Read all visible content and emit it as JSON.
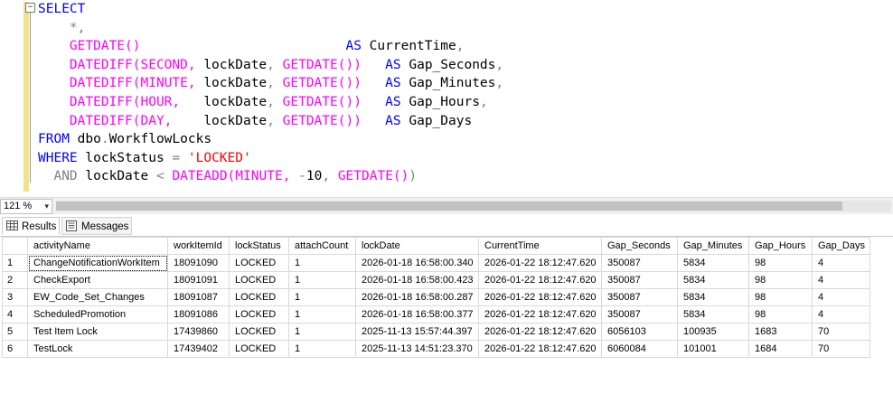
{
  "editor": {
    "lines": [
      [
        {
          "t": "SELECT",
          "c": "kw"
        }
      ],
      [
        {
          "t": "    ",
          "c": "txt"
        },
        {
          "t": "*,",
          "c": "gray"
        }
      ],
      [
        {
          "t": "    ",
          "c": "txt"
        },
        {
          "t": "GETDATE()",
          "c": "fn"
        },
        {
          "t": "                          ",
          "c": "txt"
        },
        {
          "t": "AS",
          "c": "kw"
        },
        {
          "t": " CurrentTime",
          "c": "txt"
        },
        {
          "t": ",",
          "c": "gray"
        }
      ],
      [
        {
          "t": "    ",
          "c": "txt"
        },
        {
          "t": "DATEDIFF(SECOND, ",
          "c": "fn"
        },
        {
          "t": "lockDate",
          "c": "txt"
        },
        {
          "t": ", ",
          "c": "gray"
        },
        {
          "t": "GETDATE())",
          "c": "fn"
        },
        {
          "t": "   ",
          "c": "txt"
        },
        {
          "t": "AS",
          "c": "kw"
        },
        {
          "t": " Gap_Seconds",
          "c": "txt"
        },
        {
          "t": ",",
          "c": "gray"
        }
      ],
      [
        {
          "t": "    ",
          "c": "txt"
        },
        {
          "t": "DATEDIFF(MINUTE, ",
          "c": "fn"
        },
        {
          "t": "lockDate",
          "c": "txt"
        },
        {
          "t": ", ",
          "c": "gray"
        },
        {
          "t": "GETDATE())",
          "c": "fn"
        },
        {
          "t": "   ",
          "c": "txt"
        },
        {
          "t": "AS",
          "c": "kw"
        },
        {
          "t": " Gap_Minutes",
          "c": "txt"
        },
        {
          "t": ",",
          "c": "gray"
        }
      ],
      [
        {
          "t": "    ",
          "c": "txt"
        },
        {
          "t": "DATEDIFF(HOUR,   ",
          "c": "fn"
        },
        {
          "t": "lockDate",
          "c": "txt"
        },
        {
          "t": ", ",
          "c": "gray"
        },
        {
          "t": "GETDATE())",
          "c": "fn"
        },
        {
          "t": "   ",
          "c": "txt"
        },
        {
          "t": "AS",
          "c": "kw"
        },
        {
          "t": " Gap_Hours",
          "c": "txt"
        },
        {
          "t": ",",
          "c": "gray"
        }
      ],
      [
        {
          "t": "    ",
          "c": "txt"
        },
        {
          "t": "DATEDIFF(DAY,    ",
          "c": "fn"
        },
        {
          "t": "lockDate",
          "c": "txt"
        },
        {
          "t": ", ",
          "c": "gray"
        },
        {
          "t": "GETDATE())",
          "c": "fn"
        },
        {
          "t": "   ",
          "c": "txt"
        },
        {
          "t": "AS",
          "c": "kw"
        },
        {
          "t": " Gap_Days",
          "c": "txt"
        }
      ],
      [
        {
          "t": "FROM",
          "c": "kw"
        },
        {
          "t": " dbo",
          "c": "txt"
        },
        {
          "t": ".",
          "c": "gray"
        },
        {
          "t": "WorkflowLocks",
          "c": "txt"
        }
      ],
      [
        {
          "t": "WHERE",
          "c": "kw"
        },
        {
          "t": " lockStatus ",
          "c": "txt"
        },
        {
          "t": "=",
          "c": "gray"
        },
        {
          "t": " ",
          "c": "txt"
        },
        {
          "t": "'LOCKED'",
          "c": "str"
        }
      ],
      [
        {
          "t": "  ",
          "c": "txt"
        },
        {
          "t": "AND",
          "c": "gray"
        },
        {
          "t": " lockDate ",
          "c": "txt"
        },
        {
          "t": "<",
          "c": "gray"
        },
        {
          "t": " ",
          "c": "txt"
        },
        {
          "t": "DATEADD(MINUTE, ",
          "c": "fn"
        },
        {
          "t": "-",
          "c": "gray"
        },
        {
          "t": "10",
          "c": "txt"
        },
        {
          "t": ", ",
          "c": "gray"
        },
        {
          "t": "GETDATE()",
          "c": "fn"
        },
        {
          "t": ")",
          "c": "gray"
        }
      ]
    ],
    "collapse_symbol": "−"
  },
  "zoom": {
    "value": "121 %",
    "arrow": "▾"
  },
  "tabs": {
    "results": "Results",
    "messages": "Messages"
  },
  "grid": {
    "columns": [
      "activityName",
      "workItemId",
      "lockStatus",
      "attachCount",
      "lockDate",
      "CurrentTime",
      "Gap_Seconds",
      "Gap_Minutes",
      "Gap_Hours",
      "Gap_Days"
    ],
    "rows": [
      [
        "1",
        "ChangeNotificationWorkItem",
        "18091090",
        "LOCKED",
        "1",
        "2026-01-18 16:58:00.340",
        "2026-01-22 18:12:47.620",
        "350087",
        "5834",
        "98",
        "4"
      ],
      [
        "2",
        "CheckExport",
        "18091091",
        "LOCKED",
        "1",
        "2026-01-18 16:58:00.423",
        "2026-01-22 18:12:47.620",
        "350087",
        "5834",
        "98",
        "4"
      ],
      [
        "3",
        "EW_Code_Set_Changes",
        "18091087",
        "LOCKED",
        "1",
        "2026-01-18 16:58:00.287",
        "2026-01-22 18:12:47.620",
        "350087",
        "5834",
        "98",
        "4"
      ],
      [
        "4",
        "ScheduledPromotion",
        "18091086",
        "LOCKED",
        "1",
        "2026-01-18 16:58:00.377",
        "2026-01-22 18:12:47.620",
        "350087",
        "5834",
        "98",
        "4"
      ],
      [
        "5",
        "Test Item Lock",
        "17439860",
        "LOCKED",
        "1",
        "2025-11-13 15:57:44.397",
        "2026-01-22 18:12:47.620",
        "6056103",
        "100935",
        "1683",
        "70"
      ],
      [
        "6",
        "TestLock",
        "17439402",
        "LOCKED",
        "1",
        "2025-11-13 14:51:23.370",
        "2026-01-22 18:12:47.620",
        "6060084",
        "101001",
        "1684",
        "70"
      ]
    ]
  }
}
